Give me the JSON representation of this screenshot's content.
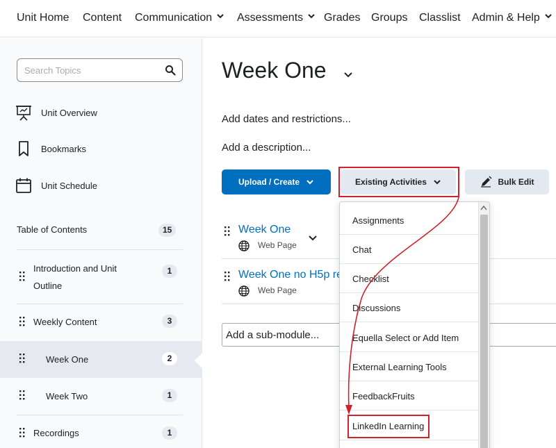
{
  "nav": {
    "items": [
      {
        "label": "Unit Home"
      },
      {
        "label": "Content"
      },
      {
        "label": "Communication"
      },
      {
        "label": "Assessments"
      },
      {
        "label": "Grades"
      },
      {
        "label": "Groups"
      },
      {
        "label": "Classlist"
      },
      {
        "label": "Admin & Help"
      }
    ]
  },
  "sidebar": {
    "search_placeholder": "Search Topics",
    "links": [
      {
        "label": "Unit Overview",
        "icon": "presentation-board-icon"
      },
      {
        "label": "Bookmarks",
        "icon": "bookmark-icon"
      },
      {
        "label": "Unit Schedule",
        "icon": "calendar-icon"
      }
    ],
    "toc_label": "Table of Contents",
    "toc_count": "15",
    "toc_items": [
      {
        "label": "Introduction and Unit Outline",
        "count": "1"
      },
      {
        "label": "Weekly Content",
        "count": "3"
      },
      {
        "label": "Week One",
        "count": "2"
      },
      {
        "label": "Week Two",
        "count": "1"
      },
      {
        "label": "Recordings",
        "count": "1"
      }
    ]
  },
  "main": {
    "title": "Week One",
    "add_dates": "Add dates and restrictions...",
    "add_description": "Add a description...",
    "buttons": {
      "upload_create": "Upload / Create",
      "existing_activities": "Existing Activities",
      "bulk_edit": "Bulk Edit"
    },
    "topics": [
      {
        "title": "Week One",
        "type": "Web Page"
      },
      {
        "title": "Week One no H5p re",
        "type": "Web Page"
      }
    ],
    "add_submodule": "Add a sub-module..."
  },
  "dropdown": {
    "items": [
      {
        "label": "Assignments"
      },
      {
        "label": "Chat"
      },
      {
        "label": "Checklist"
      },
      {
        "label": "Discussions"
      },
      {
        "label": "Equella Select or Add Item"
      },
      {
        "label": "External Learning Tools"
      },
      {
        "label": "FeedbackFruits"
      },
      {
        "label": "LinkedIn Learning"
      }
    ]
  },
  "colors": {
    "primary": "#006fbf",
    "highlight": "#d0202c",
    "selected_bg": "#e6eaf0"
  }
}
